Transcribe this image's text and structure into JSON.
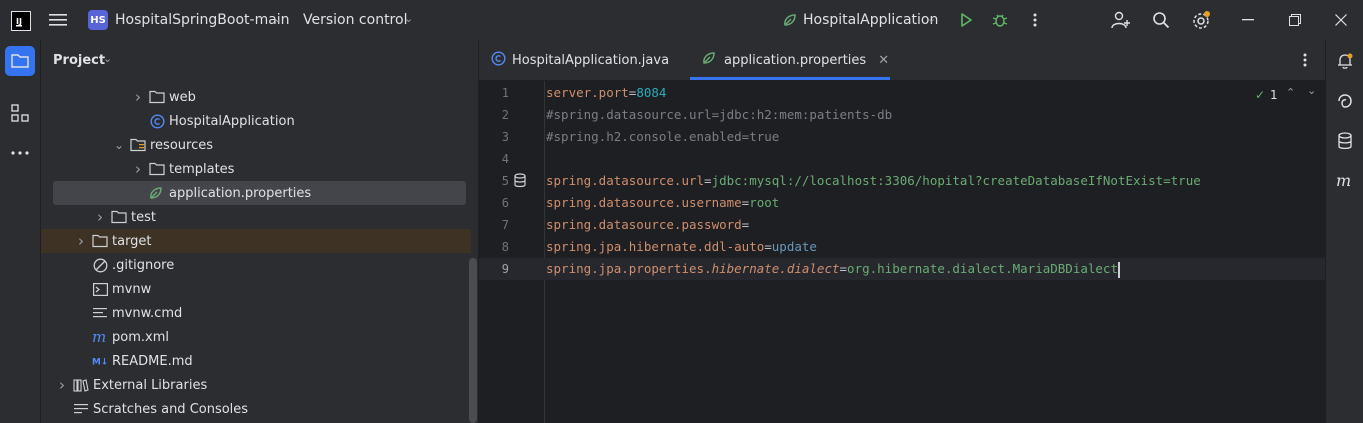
{
  "titlebar": {
    "project_badge": "HS",
    "project_name": "HospitalSpringBoot-main",
    "vcs_label": "Version control",
    "run_config": "HospitalApplication"
  },
  "project_panel": {
    "title": "Project",
    "tree": [
      {
        "label": "web",
        "icon": "folder-icon",
        "depth": 3,
        "expandable": true,
        "expanded": false
      },
      {
        "label": "HospitalApplication",
        "icon": "spring-class-icon",
        "depth": 3,
        "expandable": false
      },
      {
        "label": "resources",
        "icon": "resources-folder-icon",
        "depth": 2,
        "expandable": true,
        "expanded": true
      },
      {
        "label": "templates",
        "icon": "folder-icon",
        "depth": 3,
        "expandable": true,
        "expanded": false
      },
      {
        "label": "application.properties",
        "icon": "spring-properties-icon",
        "depth": 3,
        "expandable": false,
        "selected": true
      },
      {
        "label": "test",
        "icon": "folder-icon",
        "depth": 1,
        "expandable": true,
        "expanded": false
      },
      {
        "label": "target",
        "icon": "folder-icon",
        "depth": 0,
        "expandable": true,
        "expanded": false,
        "highlight": true
      },
      {
        "label": ".gitignore",
        "icon": "gitignore-icon",
        "depth": 0,
        "expandable": false
      },
      {
        "label": "mvnw",
        "icon": "terminal-file-icon",
        "depth": 0,
        "expandable": false
      },
      {
        "label": "mvnw.cmd",
        "icon": "text-file-icon",
        "depth": 0,
        "expandable": false
      },
      {
        "label": "pom.xml",
        "icon": "maven-icon",
        "depth": 0,
        "expandable": false
      },
      {
        "label": "README.md",
        "icon": "markdown-icon",
        "depth": 0,
        "expandable": false
      },
      {
        "label": "External Libraries",
        "icon": "library-icon",
        "depth": -1,
        "expandable": true,
        "expanded": false
      },
      {
        "label": "Scratches and Consoles",
        "icon": "scratches-icon",
        "depth": -1,
        "expandable": false
      }
    ]
  },
  "editor": {
    "tabs": [
      {
        "label": "HospitalApplication.java",
        "active": false
      },
      {
        "label": "application.properties",
        "active": true
      }
    ],
    "inspection_count": "1",
    "lines": [
      {
        "num": "1",
        "key": "server.port",
        "value": "8084",
        "kind": "num"
      },
      {
        "num": "2",
        "comment": "#spring.datasource.url=jdbc:h2:mem:patients-db"
      },
      {
        "num": "3",
        "comment": "#spring.h2.console.enabled=true"
      },
      {
        "num": "4"
      },
      {
        "num": "5",
        "key": "spring.datasource.url",
        "value": "jdbc:mysql://localhost:3306/hopital?createDatabaseIfNotExist=true",
        "kind": "str"
      },
      {
        "num": "6",
        "key": "spring.datasource.username",
        "value": "root",
        "kind": "str"
      },
      {
        "num": "7",
        "key": "spring.datasource.password",
        "value": "",
        "kind": "str"
      },
      {
        "num": "8",
        "key": "spring.jpa.hibernate.ddl-auto",
        "value": "update",
        "kind": "kw"
      },
      {
        "num": "9",
        "key_prefix": "spring.jpa.properties.",
        "key_italic": "hibernate.dialect",
        "value": "org.hibernate.dialect.MariaDBDialect",
        "kind": "str",
        "current": true
      }
    ]
  },
  "colors": {
    "accent": "#3574f0",
    "badge": "#5865d6",
    "run": "#5fb865",
    "target_highlight": "#3d3223"
  }
}
